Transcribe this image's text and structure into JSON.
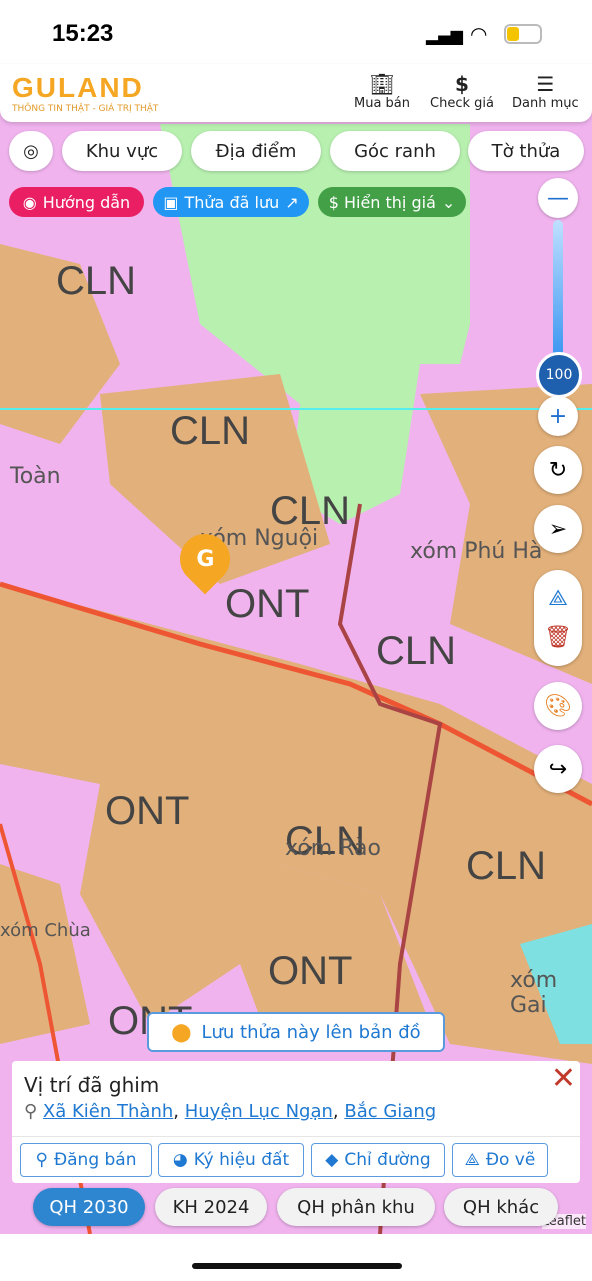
{
  "status": {
    "time": "15:23"
  },
  "header": {
    "logo": "GULAND",
    "tagline": "THÔNG TIN THẬT - GIÁ TRỊ THẬT",
    "buttons": [
      {
        "label": "Mua bán",
        "icon": "building-icon"
      },
      {
        "label": "Check giá",
        "icon": "dollar-icon"
      },
      {
        "label": "Danh mục",
        "icon": "menu-icon"
      }
    ]
  },
  "search_tabs": [
    "Khu vực",
    "Địa điểm",
    "Góc ranh",
    "Tờ thửa"
  ],
  "chips": [
    {
      "label": "Hướng dẫn",
      "color": "#e91e63"
    },
    {
      "label": "Thửa đã lưu",
      "color": "#2196f3"
    },
    {
      "label": "$ Hiển thị giá",
      "color": "#43a047"
    }
  ],
  "zoom": {
    "value": "100"
  },
  "map": {
    "zones": [
      "CLN",
      "CLN",
      "CLN",
      "CLN",
      "CLN",
      "CLN",
      "ONT",
      "ONT",
      "ONT",
      "ONT"
    ],
    "places": [
      "Toàn",
      "xóm Nguội",
      "xóm Phú Hà",
      "xóm Rào",
      "xóm Chùa",
      "xóm Gai"
    ],
    "attribution": "Leaflet"
  },
  "save_button": "Lưu thửa này lên bản đồ",
  "card": {
    "title": "Vị trí đã ghim",
    "commune": "Xã Kiên Thành",
    "district": "Huyện Lục Ngạn",
    "province": "Bắc Giang",
    "actions": [
      "Đăng bán",
      "Ký hiệu đất",
      "Chỉ đường",
      "Đo vẽ"
    ]
  },
  "layers": [
    {
      "label": "QH 2030",
      "active": true
    },
    {
      "label": "KH 2024"
    },
    {
      "label": "QH phân khu"
    },
    {
      "label": "QH khác"
    }
  ]
}
